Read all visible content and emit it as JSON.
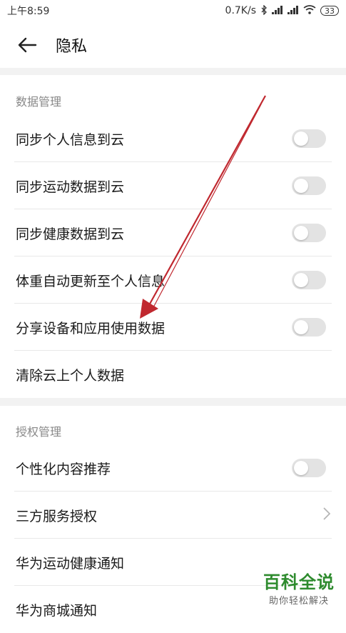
{
  "status_bar": {
    "time": "上午8:59",
    "net_speed": "0.7K/s",
    "battery": "33"
  },
  "header": {
    "title": "隐私"
  },
  "sections": [
    {
      "header": "数据管理"
    },
    {
      "header": "授权管理"
    }
  ],
  "data_rows": [
    {
      "label": "同步个人信息到云",
      "toggle_on": false
    },
    {
      "label": "同步运动数据到云",
      "toggle_on": false
    },
    {
      "label": "同步健康数据到云",
      "toggle_on": false
    },
    {
      "label": "体重自动更新至个人信息",
      "toggle_on": false
    },
    {
      "label": "分享设备和应用使用数据",
      "toggle_on": false
    },
    {
      "label": "清除云上个人数据"
    }
  ],
  "auth_rows": [
    {
      "label": "个性化内容推荐",
      "toggle_on": false
    },
    {
      "label": "三方服务授权"
    },
    {
      "label": "华为运动健康通知"
    },
    {
      "label": "华为商城通知"
    }
  ],
  "watermark": {
    "main": "百科全说",
    "sub": "助你轻松解决"
  },
  "colors": {
    "toggle_off": "#e3e3e3",
    "annotation_arrow": "#c0282f",
    "watermark_green": "#2e8b2e"
  }
}
